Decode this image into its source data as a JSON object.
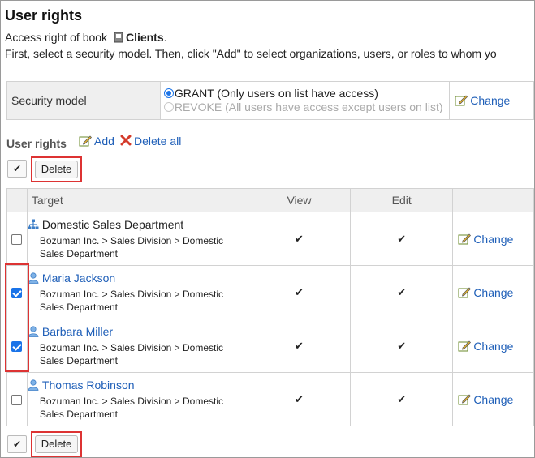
{
  "page": {
    "title": "User rights",
    "access_prefix": "Access right of book",
    "book_name": "Clients",
    "instruction": "First, select a security model. Then, click \"Add\" to select organizations, users, or roles to whom yo"
  },
  "security": {
    "label": "Security model",
    "grant": "GRANT (Only users on list have access)",
    "revoke": "REVOKE (All users have access except users on list)",
    "change": "Change"
  },
  "rights": {
    "heading": "User rights",
    "add": "Add",
    "delete_all": "Delete all",
    "check_mark": "✔",
    "delete": "Delete",
    "columns": {
      "target": "Target",
      "view": "View",
      "edit": "Edit"
    },
    "rows": [
      {
        "name": "Domestic Sales Department",
        "type": "organization",
        "path": "Bozuman Inc. > Sales Division > Domestic Sales Department",
        "checked": false,
        "view": "✔",
        "edit": "✔",
        "change": "Change"
      },
      {
        "name": "Maria Jackson",
        "type": "user",
        "path": "Bozuman Inc. > Sales Division > Domestic Sales Department",
        "checked": true,
        "view": "✔",
        "edit": "✔",
        "change": "Change"
      },
      {
        "name": "Barbara Miller",
        "type": "user",
        "path": "Bozuman Inc. > Sales Division > Domestic Sales Department",
        "checked": true,
        "view": "✔",
        "edit": "✔",
        "change": "Change"
      },
      {
        "name": "Thomas Robinson",
        "type": "user",
        "path": "Bozuman Inc. > Sales Division > Domestic Sales Department",
        "checked": false,
        "view": "✔",
        "edit": "✔",
        "change": "Change"
      }
    ]
  },
  "colors": {
    "link": "#1f5fb8",
    "highlight": "#dd3333",
    "checkbox": "#1a73e8"
  },
  "icons": {
    "book": "book-icon",
    "pen": "edit-pen-icon",
    "delete": "x-icon",
    "org": "org-chart-icon",
    "user": "user-icon"
  }
}
